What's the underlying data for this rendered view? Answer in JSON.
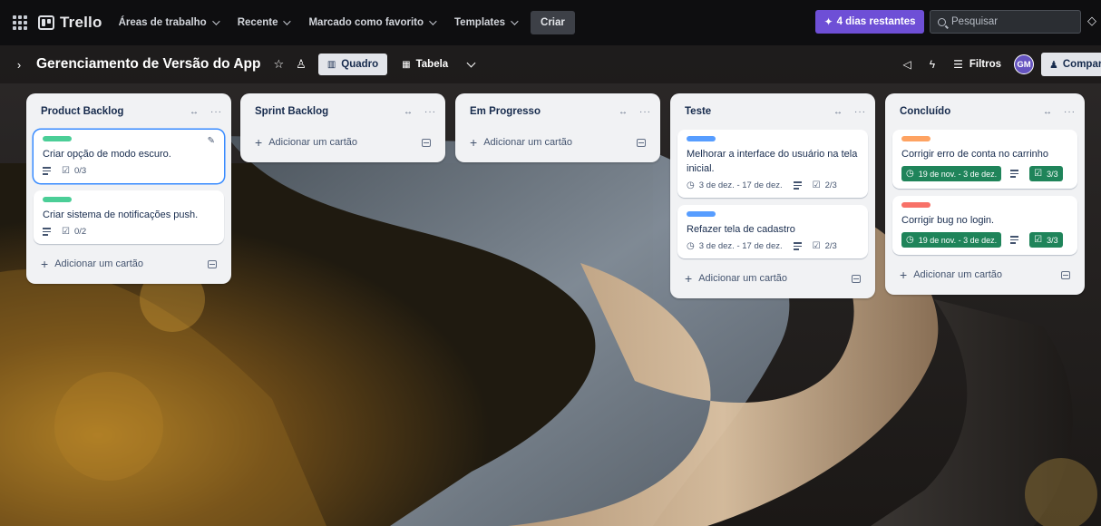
{
  "topnav": {
    "logo": "Trello",
    "items": [
      {
        "label": "Áreas de trabalho"
      },
      {
        "label": "Recente"
      },
      {
        "label": "Marcado como favorito"
      },
      {
        "label": "Templates"
      }
    ],
    "create_label": "Criar",
    "trial_label": "4 dias restantes",
    "search_placeholder": "Pesquisar"
  },
  "board": {
    "title": "Gerenciamento de Versão do App",
    "views": [
      {
        "label": "Quadro",
        "active": true
      },
      {
        "label": "Tabela",
        "active": false
      }
    ],
    "filters_label": "Filtros",
    "avatar_initials": "GM",
    "share_label": "Compartilhar"
  },
  "add_card_label": "Adicionar um cartão",
  "lists": [
    {
      "title": "Product Backlog",
      "cards": [
        {
          "label_color": "#4bce97",
          "text": "Criar opção de modo escuro.",
          "checklist": "0/3",
          "has_description": true
        },
        {
          "label_color": "#4bce97",
          "text": "Criar sistema de notificações push.",
          "checklist": "0/2",
          "has_description": true
        }
      ]
    },
    {
      "title": "Sprint Backlog",
      "cards": []
    },
    {
      "title": "Em Progresso",
      "cards": []
    },
    {
      "title": "Teste",
      "cards": [
        {
          "label_color": "#579dff",
          "text": "Melhorar a interface do usuário na tela inicial.",
          "dates": "3 de dez. - 17 de dez.",
          "checklist": "2/3",
          "has_description": true
        },
        {
          "label_color": "#579dff",
          "text": "Refazer tela de cadastro",
          "dates": "3 de dez. - 17 de dez.",
          "checklist": "2/3",
          "has_description": true
        }
      ]
    },
    {
      "title": "Concluído",
      "cards": [
        {
          "label_color": "#fea362",
          "text": "Corrigir erro de conta no carrinho",
          "dates": "19 de nov. - 3 de dez.",
          "checklist": "3/3",
          "has_description": true,
          "complete": true
        },
        {
          "label_color": "#f87168",
          "text": "Corrigir bug no login.",
          "dates": "19 de nov. - 3 de dez.",
          "checklist": "3/3",
          "has_description": true,
          "complete": true
        }
      ]
    }
  ]
}
